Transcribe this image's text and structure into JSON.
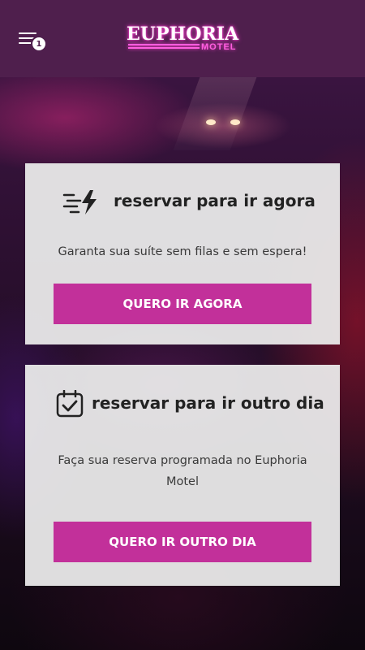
{
  "header": {
    "menu_badge": "1",
    "logo_text": "EUPHORIA",
    "logo_sub": "MOTEL"
  },
  "cards": [
    {
      "title": "reservar para ir agora",
      "description": "Garanta sua suíte sem filas e sem espera!",
      "button_label": "QUERO IR AGORA",
      "icon": "fast-lightning-icon"
    },
    {
      "title": "reservar para ir outro dia",
      "description": "Faça sua reserva programada no Euphoria Motel",
      "button_label": "QUERO IR OUTRO DIA",
      "icon": "calendar-check-icon"
    }
  ],
  "colors": {
    "header_bg": "#4f1f4d",
    "button_bg": "#c2309a",
    "logo_glow": "#ff3fd2"
  }
}
